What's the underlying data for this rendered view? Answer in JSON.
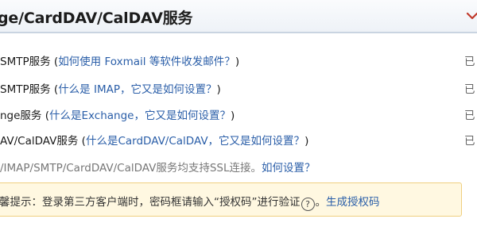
{
  "header": {
    "title": "ge/CardDAV/CalDAV服务"
  },
  "services": [
    {
      "name": "SMTP服务",
      "help_prefix": "(",
      "help_link": "如何使用 Foxmail 等软件收发邮件？",
      "help_suffix": ")",
      "status": "已"
    },
    {
      "name": "SMTP服务",
      "help_prefix": "(",
      "help_link": "什么是 IMAP，它又是如何设置？",
      "help_suffix": ")",
      "status": "已"
    },
    {
      "name": "nge服务",
      "help_prefix": "(",
      "help_link": "什么是Exchange，它又是如何设置？",
      "help_suffix": ")",
      "status": "已"
    },
    {
      "name": "AV/CalDAV服务",
      "help_prefix": "(",
      "help_link": "什么是CardDAV/CalDAV，它又是如何设置？",
      "help_suffix": ")",
      "status": "已"
    }
  ],
  "ssl_note": {
    "text": "/IMAP/SMTP/CardDAV/CalDAV服务均支持SSL连接。",
    "link": "如何设置？"
  },
  "warning": {
    "text": "馨提示：登录第三方客户端时，密码框请输入“授权码”进行验证",
    "help_glyph": "?",
    "separator": "。",
    "link": "生成授权码"
  }
}
